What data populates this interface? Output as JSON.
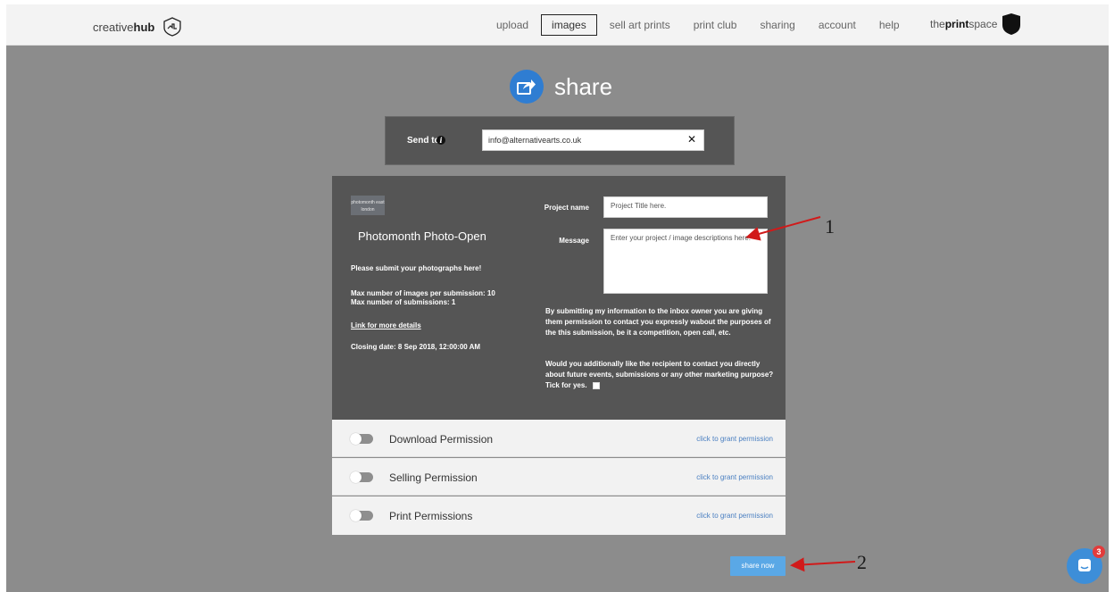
{
  "nav": {
    "brand_light": "creative",
    "brand_bold": "hub",
    "links": [
      "upload",
      "images",
      "sell art prints",
      "print club",
      "sharing",
      "account",
      "help"
    ],
    "active_link": "images",
    "partner_prefix": "the",
    "partner_bold": "print",
    "partner_suffix": "space"
  },
  "share": {
    "title": "share",
    "icon": "share-arrow-icon",
    "accent": "#2f7dd2"
  },
  "send_to": {
    "label": "Send to",
    "value": "info@alternativearts.co.uk",
    "clear": "✕"
  },
  "org": {
    "logo_text": "photomonth east london",
    "name": "Photomonth Photo-Open",
    "intro": "Please submit your photographs here!",
    "max_images": "Max number of images per submission: 10",
    "max_submissions": "Max number of submissions: 1",
    "details_link": "Link for more details",
    "closing": "Closing date: 8 Sep 2018, 12:00:00 AM"
  },
  "form": {
    "project_label": "Project name",
    "project_value": "Project Title here.",
    "message_label": "Message",
    "message_value": "Enter your project / image descriptions here.",
    "consent_1": "By submitting my information to the inbox owner you are giving them permission to contact you expressly wabout the purposes of the this submission, be it a competition, open call, etc.",
    "consent_2": "Would you additionally like the recipient to contact you directly about future events, submissions or any other marketing purpose? Tick for yes."
  },
  "permissions": [
    {
      "label": "Download Permission",
      "link": "click to grant permission",
      "enabled": false
    },
    {
      "label": "Selling Permission",
      "link": "click to grant permission",
      "enabled": false
    },
    {
      "label": "Print Permissions",
      "link": "click to grant permission",
      "enabled": false
    }
  ],
  "share_button": "share now",
  "annotations": [
    "1",
    "2"
  ],
  "chat": {
    "badge": "3"
  }
}
